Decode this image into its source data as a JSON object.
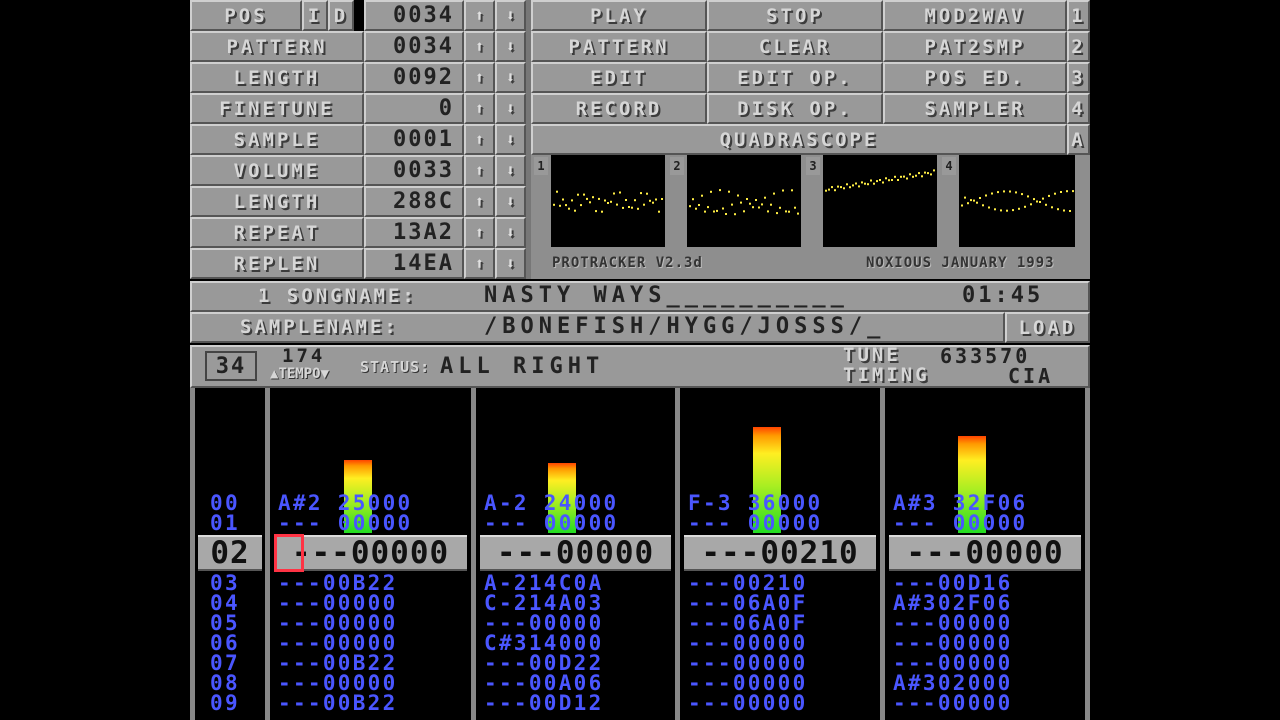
{
  "buttons": {
    "pos": "POS",
    "ins": "I",
    "del": "D",
    "pattern": "PATTERN",
    "length": "LENGTH",
    "finetune": "FINETUNE",
    "sample": "SAMPLE",
    "volume": "VOLUME",
    "sample_length": "LENGTH",
    "repeat": "REPEAT",
    "replen": "REPLEN",
    "play": "PLAY",
    "stop": "STOP",
    "mod2wav": "MOD2WAV",
    "play_pattern": "PATTERN",
    "clear": "CLEAR",
    "pat2smp": "PAT2SMP",
    "edit": "EDIT",
    "edit_op": "EDIT OP.",
    "pos_ed": "POS ED.",
    "record": "RECORD",
    "disk_op": "DISK OP.",
    "sampler": "SAMPLER",
    "quadrascope": "QUADRASCOPE",
    "load": "LOAD",
    "side_1": "1",
    "side_2": "2",
    "side_3": "3",
    "side_4": "4",
    "side_a": "A"
  },
  "values": {
    "pos": "0034",
    "pattern": "0034",
    "length": "0092",
    "finetune": "0",
    "sample": "0001",
    "volume": "0033",
    "sample_length": "288C",
    "repeat": "13A2",
    "replen": "14EA"
  },
  "info": {
    "version": "PROTRACKER V2.3d",
    "credit": "NOXIOUS JANUARY 1993",
    "songname_label": "1 SONGNAME:",
    "songname": "NASTY WAYS__________",
    "time": "01:45",
    "samplename_label": "SAMPLENAME:",
    "samplename": "/BONEFISH/HYGG/JOSSS/_",
    "position": "34",
    "tempo_value": "174",
    "tempo_label": "TEMPO",
    "status_label": "STATUS:",
    "status": "ALL RIGHT",
    "tune_label": "TUNE",
    "tune": "633570",
    "timing_label": "TIMING",
    "timing": "CIA"
  },
  "scope_channels": [
    "1",
    "2",
    "3",
    "4"
  ],
  "scope_color": "#ffee44",
  "accent_colors": {
    "pattern_text": "#4a56ff",
    "cursor": "#ff3344",
    "panel": "#999999"
  },
  "vu_levels": [
    0.68,
    0.65,
    0.98,
    0.9
  ],
  "pattern": {
    "current_row": "02",
    "rows_above": [
      {
        "num": "00",
        "c": [
          "A#2 25000",
          "A-2 24000",
          "F-3 36000",
          "A#3 32F06"
        ]
      },
      {
        "num": "01",
        "c": [
          "--- 00000",
          "--- 00000",
          "--- 00000",
          "--- 00000"
        ]
      }
    ],
    "current": [
      "---00000",
      "---00000",
      "---00210",
      "---00000"
    ],
    "rows_below": [
      {
        "num": "03",
        "c": [
          "---00B22",
          "A-214C0A",
          "---00210",
          "---00D16"
        ]
      },
      {
        "num": "04",
        "c": [
          "---00000",
          "C-214A03",
          "---06A0F",
          "A#302F06"
        ]
      },
      {
        "num": "05",
        "c": [
          "---00000",
          "---00000",
          "---06A0F",
          "---00000"
        ]
      },
      {
        "num": "06",
        "c": [
          "---00000",
          "C#314000",
          "---00000",
          "---00000"
        ]
      },
      {
        "num": "07",
        "c": [
          "---00B22",
          "---00D22",
          "---00000",
          "---00000"
        ]
      },
      {
        "num": "08",
        "c": [
          "---00000",
          "---00A06",
          "---00000",
          "A#302000"
        ]
      },
      {
        "num": "09",
        "c": [
          "---00B22",
          "---00D12",
          "---00000",
          "---00000"
        ]
      }
    ]
  }
}
